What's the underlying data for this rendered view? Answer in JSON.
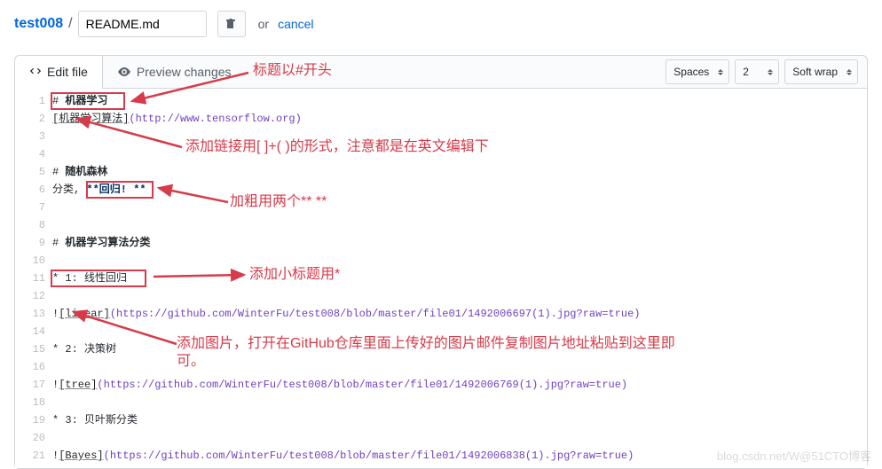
{
  "breadcrumb": {
    "repo": "test008",
    "sep": "/",
    "filename": "README.md",
    "or": "or",
    "cancel": "cancel"
  },
  "tabs": {
    "edit": "Edit file",
    "preview": "Preview changes"
  },
  "toolbar": {
    "indent_mode": "Spaces",
    "indent_size": "2",
    "wrap_mode": "Soft wrap"
  },
  "icons": {
    "code": "code-icon",
    "eye": "eye-icon",
    "clipboard": "clipboard-icon"
  },
  "code_lines": [
    {
      "n": 1,
      "segs": [
        {
          "t": "# ",
          "c": "tok-raw"
        },
        {
          "t": "机器学习",
          "c": "tok-raw",
          "bold": true
        }
      ]
    },
    {
      "n": 2,
      "segs": [
        {
          "t": "[机器学习算法]",
          "c": "tok-link"
        },
        {
          "t": "(http://www.tensorflow.org)",
          "c": "tok-url"
        }
      ]
    },
    {
      "n": 3,
      "segs": []
    },
    {
      "n": 4,
      "segs": []
    },
    {
      "n": 5,
      "segs": [
        {
          "t": "# ",
          "c": "tok-raw"
        },
        {
          "t": "随机森林",
          "c": "tok-raw",
          "bold": true
        }
      ]
    },
    {
      "n": 6,
      "segs": [
        {
          "t": "分类, ",
          "c": "tok-raw"
        },
        {
          "t": "**回归! **",
          "c": "tok-em",
          "bold": true
        }
      ]
    },
    {
      "n": 7,
      "segs": []
    },
    {
      "n": 8,
      "segs": []
    },
    {
      "n": 9,
      "segs": [
        {
          "t": "# ",
          "c": "tok-raw"
        },
        {
          "t": "机器学习算法分类",
          "c": "tok-raw",
          "bold": true
        }
      ]
    },
    {
      "n": 10,
      "segs": []
    },
    {
      "n": 11,
      "segs": [
        {
          "t": "* 1: 线性回归",
          "c": "tok-raw"
        }
      ]
    },
    {
      "n": 12,
      "segs": []
    },
    {
      "n": 13,
      "segs": [
        {
          "t": "!",
          "c": "tok-raw"
        },
        {
          "t": "[linear]",
          "c": "tok-link"
        },
        {
          "t": "(https://github.com/WinterFu/test008/blob/master/file01/1492006697(1).jpg?raw=true)",
          "c": "tok-url"
        }
      ]
    },
    {
      "n": 14,
      "segs": []
    },
    {
      "n": 15,
      "segs": [
        {
          "t": "* 2: 决策树",
          "c": "tok-raw"
        }
      ]
    },
    {
      "n": 16,
      "segs": []
    },
    {
      "n": 17,
      "segs": [
        {
          "t": "!",
          "c": "tok-raw"
        },
        {
          "t": "[tree]",
          "c": "tok-link"
        },
        {
          "t": "(https://github.com/WinterFu/test008/blob/master/file01/1492006769(1).jpg?raw=true)",
          "c": "tok-url"
        }
      ]
    },
    {
      "n": 18,
      "segs": []
    },
    {
      "n": 19,
      "segs": [
        {
          "t": "* 3: 贝叶斯分类",
          "c": "tok-raw"
        }
      ]
    },
    {
      "n": 20,
      "segs": []
    },
    {
      "n": 21,
      "segs": [
        {
          "t": "!",
          "c": "tok-raw"
        },
        {
          "t": "[Bayes]",
          "c": "tok-link"
        },
        {
          "t": "(https://github.com/WinterFu/test008/blob/master/file01/1492006838(1).jpg?raw=true)",
          "c": "tok-url"
        }
      ]
    }
  ],
  "annotations": {
    "a1": "标题以#开头",
    "a2": "添加链接用[ ]+( )的形式，注意都是在英文编辑下",
    "a3": "加粗用两个** **",
    "a4": "添加小标题用*",
    "a5_line1": "添加图片，打开在GitHub仓库里面上传好的图片邮件复制图片地址粘贴到这里即",
    "a5_line2": "可。"
  },
  "watermark": "blog.csdn.net/W@51CTO博客"
}
